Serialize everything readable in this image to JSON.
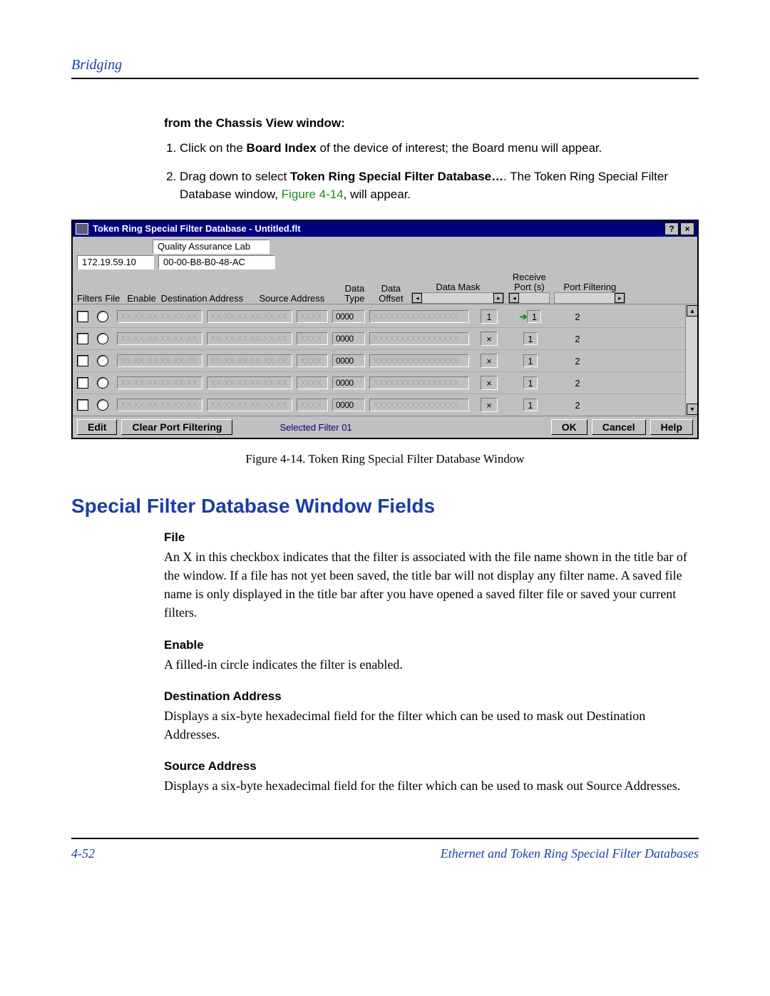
{
  "header": {
    "breadcrumb": "Bridging"
  },
  "intro": {
    "heading": "from the Chassis View window:",
    "steps": [
      {
        "pre": "Click on the ",
        "strong": "Board Index",
        "post": " of the device of interest; the Board menu will appear."
      },
      {
        "pre": "Drag down to select ",
        "strong": "Token Ring Special Filter Database…",
        "post": ". The Token Ring Special Filter Database window, ",
        "link": "Figure 4-14",
        "tail": ", will appear."
      }
    ]
  },
  "dialog": {
    "title": "Token Ring Special Filter Database - Untitled.flt",
    "help_btn": "?",
    "close_btn": "×",
    "ip": "172.19.59.10",
    "lab": "Quality Assurance Lab",
    "mac": "00-00-B8-B0-48-AC",
    "tab": "Filters",
    "columns": {
      "file": "File",
      "enable": "Enable",
      "dest": "Destination Address",
      "src": "Source Address",
      "dtype": "Data Type",
      "doff": "Data Offset",
      "dmask": "Data Mask",
      "recv": "Receive Port (s)",
      "pf": "Port Filtering"
    },
    "rows": [
      {
        "dest": "XX-XX-XX-XX-XX-XX",
        "src": "XX-XX-XX-XX-XX-XX",
        "dtype": "XXXX",
        "doff": "0000",
        "dmask": "XXXXXXXXXXXXXXXX",
        "recv": "1",
        "arrow": true,
        "pf1": "1",
        "pf2": "2"
      },
      {
        "dest": "XX-XX-XX-XX-XX-XX",
        "src": "XX-XX-XX-XX-XX-XX",
        "dtype": "XXXX",
        "doff": "0000",
        "dmask": "XXXXXXXXXXXXXXXX",
        "recv": "×",
        "arrow": false,
        "pf1": "1",
        "pf2": "2"
      },
      {
        "dest": "XX-XX-XX-XX-XX-XX",
        "src": "XX-XX-XX-XX-XX-XX",
        "dtype": "XXXX",
        "doff": "0000",
        "dmask": "XXXXXXXXXXXXXXXX",
        "recv": "×",
        "arrow": false,
        "pf1": "1",
        "pf2": "2"
      },
      {
        "dest": "XX-XX-XX-XX-XX-XX",
        "src": "XX-XX-XX-XX-XX-XX",
        "dtype": "XXXX",
        "doff": "0000",
        "dmask": "XXXXXXXXXXXXXXXX",
        "recv": "×",
        "arrow": false,
        "pf1": "1",
        "pf2": "2"
      },
      {
        "dest": "XX-XX-XX-XX-XX-XX",
        "src": "XX-XX-XX-XX-XX-XX",
        "dtype": "XXXX",
        "doff": "0000",
        "dmask": "XXXXXXXXXXXXXXXX",
        "recv": "×",
        "arrow": false,
        "pf1": "1",
        "pf2": "2"
      }
    ],
    "bottom": {
      "edit": "Edit",
      "clear": "Clear Port Filtering",
      "sel_label": "Selected Filter",
      "sel_num": "01",
      "ok": "OK",
      "cancel": "Cancel",
      "help": "Help"
    }
  },
  "caption": "Figure 4-14. Token Ring Special Filter Database Window",
  "section_heading": "Special Filter Database Window Fields",
  "fields": [
    {
      "h": "File",
      "d": "An X in this checkbox indicates that the filter is associated with the file name shown in the title bar of the window. If a file has not yet been saved, the title bar will not display any filter name. A saved file name is only displayed in the title bar after you have opened a saved filter file or saved your current filters."
    },
    {
      "h": "Enable",
      "d": "A filled-in circle indicates the filter is enabled."
    },
    {
      "h": "Destination Address",
      "d": "Displays a six-byte hexadecimal field for the filter which can be used to mask out Destination Addresses."
    },
    {
      "h": "Source Address",
      "d": "Displays a six-byte hexadecimal field for the filter which can be used to mask out Source Addresses."
    }
  ],
  "footer": {
    "page": "4-52",
    "title": "Ethernet and Token Ring Special Filter Databases"
  }
}
